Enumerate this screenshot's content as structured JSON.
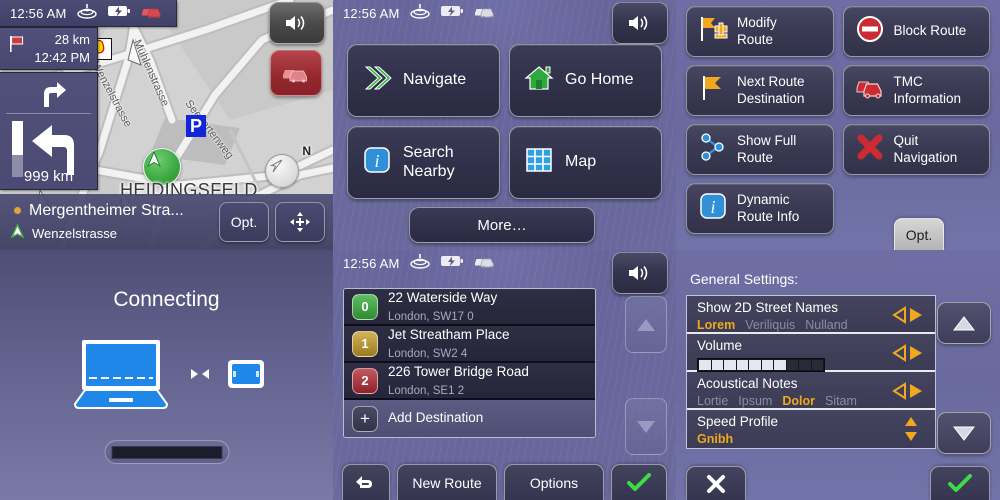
{
  "status": {
    "time": "12:56 AM",
    "icons": [
      "satellite-icon",
      "battery-charging-icon",
      "traffic-cars-icon"
    ]
  },
  "map_panel": {
    "destination": {
      "distance": "28 km",
      "eta": "12:42 PM",
      "flag_icon": "red-flag-icon"
    },
    "maneuver": {
      "next_icon": "turn-right-icon",
      "current_icon": "turn-left-icon",
      "distance": "999 km",
      "progress_percent": 60
    },
    "buttons": {
      "volume": "speaker-icon",
      "traffic": "traffic-jam-icon",
      "options": "Opt.",
      "pan": "pan-move-icon"
    },
    "compass": {
      "label": "N"
    },
    "poi": {
      "parking": "P",
      "fuel": "shell-station-icon"
    },
    "place_label": "HEIDINGSFELD",
    "streets": [
      "Wenzelstrasse",
      "Mühlenstrasse",
      "Seegartenweg"
    ],
    "current_road": "Mergentheimer Stra...",
    "next_road": "Wenzelstrasse"
  },
  "main_menu": {
    "buttons": [
      {
        "label": "Navigate",
        "icon": "chevrons-right-icon",
        "color": "#3cb54a"
      },
      {
        "label": "Go Home",
        "icon": "home-icon",
        "color": "#3cb54a"
      },
      {
        "label": "Search\nNearby",
        "line1": "Search",
        "line2": "Nearby",
        "icon": "info-icon",
        "color": "#2f8fd8"
      },
      {
        "label": "Map",
        "icon": "grid-map-icon",
        "color": "#2f9fe0"
      }
    ],
    "more_label": "More…"
  },
  "route_options": {
    "buttons": [
      {
        "line1": "Modify",
        "line2": "Route",
        "icon": "flag-plus-minus-icon",
        "color": "#f0a81e"
      },
      {
        "line1": "Block Route",
        "line2": "",
        "icon": "no-entry-icon",
        "color": "#cc2b33"
      },
      {
        "line1": "Next Route",
        "line2": "Destination",
        "icon": "flag-icon",
        "color": "#f0a81e"
      },
      {
        "line1": "TMC",
        "line2": "Information",
        "icon": "traffic-cars-icon",
        "color": "#cc2b33"
      },
      {
        "line1": "Show Full",
        "line2": "Route",
        "icon": "route-nodes-icon",
        "color": "#2f8fd8"
      },
      {
        "line1": "Quit",
        "line2": "Navigation",
        "icon": "x-cross-icon",
        "color": "#cc2b33"
      },
      {
        "line1": "Dynamic",
        "line2": "Route Info",
        "icon": "info-icon",
        "color": "#2f8fd8"
      }
    ],
    "opt_label": "Opt."
  },
  "connecting": {
    "title": "Connecting",
    "icons": {
      "source": "laptop-icon",
      "link": "left-right-arrows-icon",
      "target": "tablet-icon"
    },
    "progress_label": ""
  },
  "destination_list": {
    "items": [
      {
        "index": "0",
        "title": "22 Waterside Way",
        "subtitle": "London, SW17 0",
        "color": "green"
      },
      {
        "index": "1",
        "title": "Jet Streatham Place",
        "subtitle": "London, SW2 4",
        "color": "amber"
      },
      {
        "index": "2",
        "title": "226 Tower Bridge Road",
        "subtitle": "London, SE1 2",
        "color": "red"
      }
    ],
    "add": {
      "index": "+",
      "title": "Add Destination"
    },
    "scroll": {
      "up": "scroll-up-icon",
      "down": "scroll-down-icon"
    },
    "bottom": {
      "back": "back-arrow-icon",
      "new_route": "New Route",
      "options": "Options",
      "confirm": "checkmark-icon"
    }
  },
  "settings": {
    "title": "General Settings:",
    "rows": [
      {
        "name": "Show 2D Street Names",
        "type": "options",
        "options": [
          "Lorem",
          "Veriliquis",
          "Nulland"
        ],
        "selected": 0,
        "control": "left-right-arrows-icon"
      },
      {
        "name": "Volume",
        "type": "bar",
        "segments": 10,
        "filled": 7,
        "control": "left-right-arrows-icon"
      },
      {
        "name": "Acoustical Notes",
        "type": "options",
        "options": [
          "Lortie",
          "Ipsum",
          "Dolor",
          "Sitam"
        ],
        "selected": 2,
        "control": "left-right-arrows-icon"
      },
      {
        "name": "Speed Profile",
        "type": "value",
        "value": "Gnibh",
        "control": "up-down-arrows-icon"
      }
    ],
    "side": {
      "up": "arrow-up-icon",
      "down": "arrow-down-icon"
    },
    "bottom": {
      "cancel": "x-icon",
      "confirm": "checkmark-icon"
    },
    "accent": "#f0a81e"
  }
}
